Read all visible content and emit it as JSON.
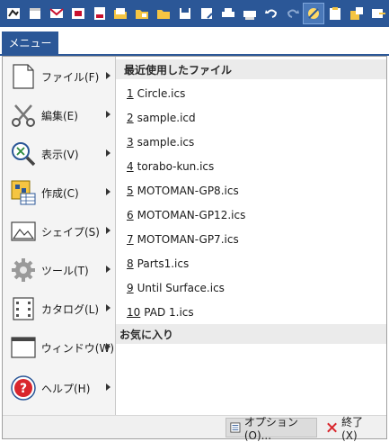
{
  "toolbar": {
    "icons": [
      "app-icon",
      "new-file-icon",
      "mail-icon",
      "open-icon",
      "new-doc-icon",
      "open-folder-icon",
      "folder-move-icon",
      "folder-open-icon",
      "save-icon",
      "save-as-icon",
      "print-icon",
      "print-setup-icon",
      "undo-icon",
      "redo-icon",
      "highlight-icon",
      "clipboard-icon",
      "paste-icon",
      "export-icon"
    ]
  },
  "menu_tab": {
    "label": "メニュー"
  },
  "left_menu": [
    {
      "label": "ファイル(F)",
      "icon": "file-icon"
    },
    {
      "label": "編集(E)",
      "icon": "scissors-icon"
    },
    {
      "label": "表示(V)",
      "icon": "zoom-icon"
    },
    {
      "label": "作成(C)",
      "icon": "create-icon"
    },
    {
      "label": "シェイプ(S)",
      "icon": "shape-icon"
    },
    {
      "label": "ツール(T)",
      "icon": "gear-icon"
    },
    {
      "label": "カタログ(L)",
      "icon": "catalog-icon"
    },
    {
      "label": "ウィンドウ(W)",
      "icon": "window-icon"
    },
    {
      "label": "ヘルプ(H)",
      "icon": "help-icon"
    }
  ],
  "recent_files": {
    "header": "最近使用したファイル",
    "items": [
      {
        "num": "1",
        "name": "Circle.ics"
      },
      {
        "num": "2",
        "name": "sample.icd"
      },
      {
        "num": "3",
        "name": "sample.ics"
      },
      {
        "num": "4",
        "name": "torabo-kun.ics"
      },
      {
        "num": "5",
        "name": "MOTOMAN-GP8.ics"
      },
      {
        "num": "6",
        "name": "MOTOMAN-GP12.ics"
      },
      {
        "num": "7",
        "name": "MOTOMAN-GP7.ics"
      },
      {
        "num": "8",
        "name": "Parts1.ics"
      },
      {
        "num": "9",
        "name": "Until Surface.ics"
      },
      {
        "num": "10",
        "name": "PAD 1.ics"
      }
    ]
  },
  "favorites": {
    "header": "お気に入り"
  },
  "footer": {
    "options_label": "オプション(O)...",
    "exit_label": "終了(X)"
  },
  "colors": {
    "accent": "#2b5797",
    "help_red": "#d9262c"
  }
}
